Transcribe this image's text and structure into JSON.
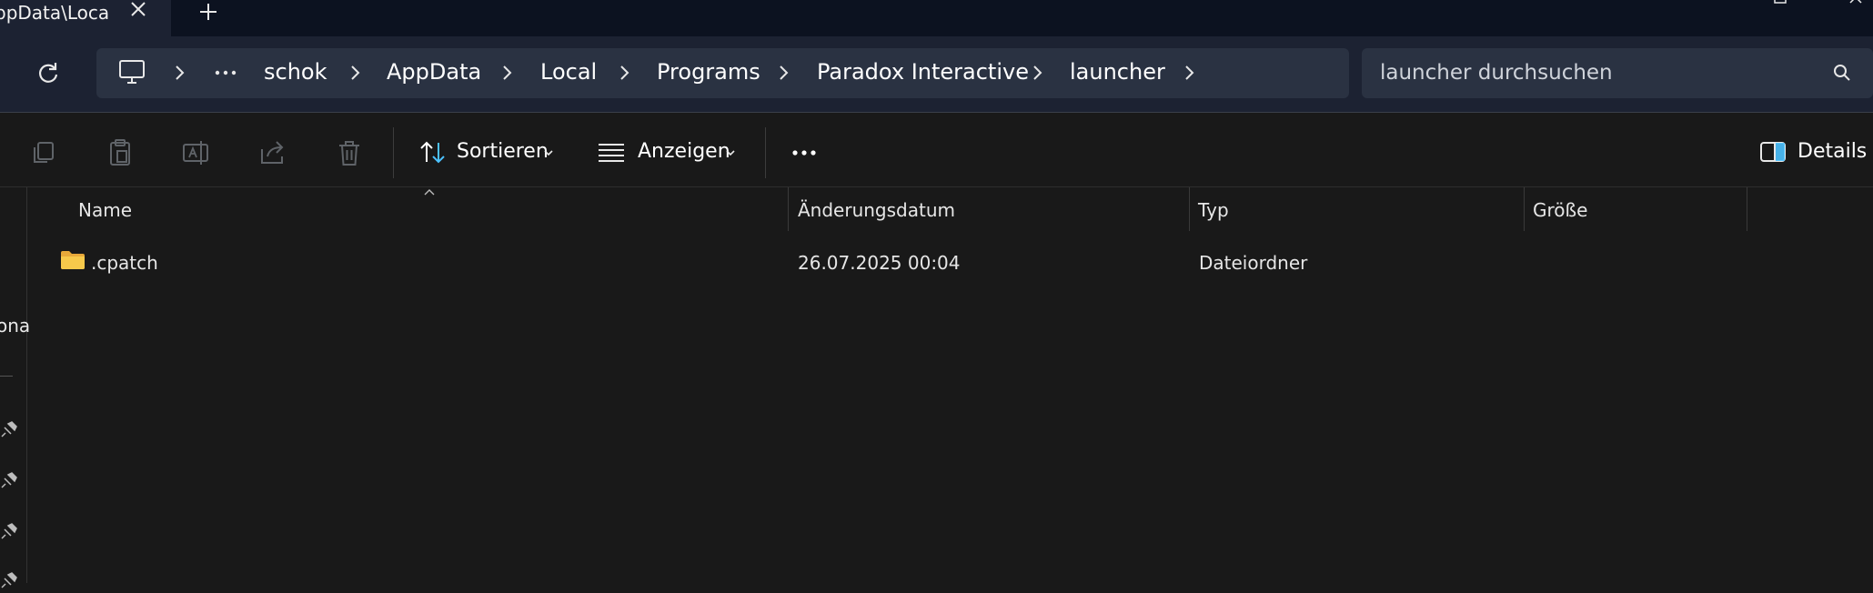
{
  "tab": {
    "title": "ppData\\Loca"
  },
  "breadcrumbs": [
    "schok",
    "AppData",
    "Local",
    "Programs",
    "Paradox Interactive",
    "launcher"
  ],
  "search": {
    "placeholder": "launcher durchsuchen"
  },
  "toolbar": {
    "sort_label": "Sortieren",
    "view_label": "Anzeigen",
    "details_label": "Details"
  },
  "nav": {
    "partial_label": "ona"
  },
  "columns": {
    "name": "Name",
    "modified": "Änderungsdatum",
    "type": "Typ",
    "size": "Größe"
  },
  "files": [
    {
      "name": ".cpatch",
      "modified": "26.07.2025 00:04",
      "type": "Dateiordner",
      "size": ""
    }
  ],
  "colors": {
    "accent": "#4cc2ff",
    "folder": "#f0c14b",
    "background": "#191919",
    "titlebar": "#0c1220",
    "addressbar": "#1c2232"
  },
  "icons": [
    "close-icon",
    "plus-icon",
    "refresh-icon",
    "computer-icon",
    "more-icon",
    "chevron-right-icon",
    "search-icon",
    "copy-icon",
    "paste-icon",
    "rename-icon",
    "share-icon",
    "delete-icon",
    "sort-icon",
    "view-icon",
    "chevron-down-icon",
    "details-pane-icon",
    "folder-icon",
    "pin-icon"
  ]
}
